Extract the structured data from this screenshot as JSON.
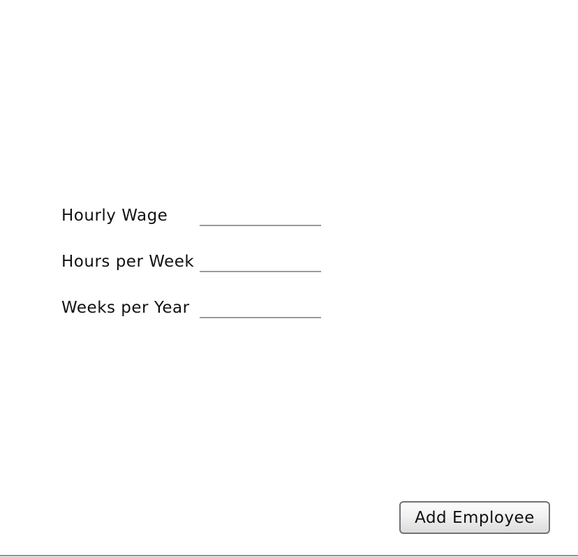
{
  "form": {
    "fields": [
      {
        "label": "Hourly Wage",
        "value": ""
      },
      {
        "label": "Hours per Week",
        "value": ""
      },
      {
        "label": "Weeks per Year",
        "value": ""
      }
    ],
    "add_button_label": "Add Employee"
  }
}
